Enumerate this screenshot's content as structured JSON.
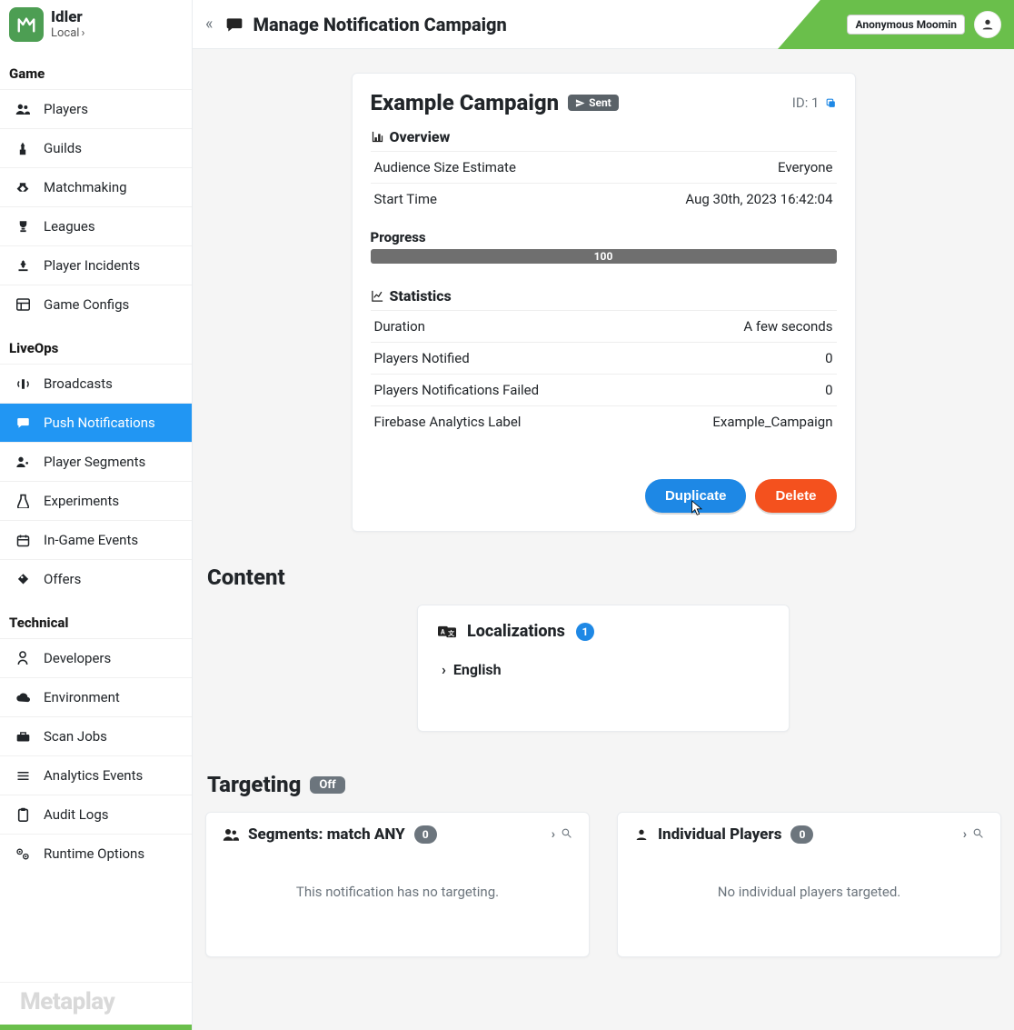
{
  "app": {
    "name": "Idler",
    "env": "Local"
  },
  "header": {
    "title": "Manage Notification Campaign",
    "user": "Anonymous Moomin"
  },
  "nav": {
    "sections": [
      {
        "title": "Game",
        "items": [
          {
            "label": "Players"
          },
          {
            "label": "Guilds"
          },
          {
            "label": "Matchmaking"
          },
          {
            "label": "Leagues"
          },
          {
            "label": "Player Incidents"
          },
          {
            "label": "Game Configs"
          }
        ]
      },
      {
        "title": "LiveOps",
        "items": [
          {
            "label": "Broadcasts"
          },
          {
            "label": "Push Notifications",
            "active": true
          },
          {
            "label": "Player Segments"
          },
          {
            "label": "Experiments"
          },
          {
            "label": "In-Game Events"
          },
          {
            "label": "Offers"
          }
        ]
      },
      {
        "title": "Technical",
        "items": [
          {
            "label": "Developers"
          },
          {
            "label": "Environment"
          },
          {
            "label": "Scan Jobs"
          },
          {
            "label": "Analytics Events"
          },
          {
            "label": "Audit Logs"
          },
          {
            "label": "Runtime Options"
          }
        ]
      }
    ],
    "footer": "Metaplay"
  },
  "campaign": {
    "title": "Example Campaign",
    "status": "Sent",
    "id_label": "ID: 1",
    "overview_heading": "Overview",
    "overview": [
      {
        "k": "Audience Size Estimate",
        "v": "Everyone"
      },
      {
        "k": "Start Time",
        "v": "Aug 30th, 2023 16:42:04"
      }
    ],
    "progress_label": "Progress",
    "progress_value": "100",
    "stats_heading": "Statistics",
    "stats": [
      {
        "k": "Duration",
        "v": "A few seconds"
      },
      {
        "k": "Players Notified",
        "v": "0"
      },
      {
        "k": "Players Notifications Failed",
        "v": "0"
      },
      {
        "k": "Firebase Analytics Label",
        "v": "Example_Campaign"
      }
    ],
    "buttons": {
      "duplicate": "Duplicate",
      "delete": "Delete"
    }
  },
  "content": {
    "heading": "Content",
    "localizations": {
      "title": "Localizations",
      "count": "1",
      "items": [
        "English"
      ]
    }
  },
  "targeting": {
    "heading": "Targeting",
    "state": "Off",
    "segments": {
      "title": "Segments: match ANY",
      "count": "0",
      "empty": "This notification has no targeting."
    },
    "players": {
      "title": "Individual Players",
      "count": "0",
      "empty": "No individual players targeted."
    }
  }
}
